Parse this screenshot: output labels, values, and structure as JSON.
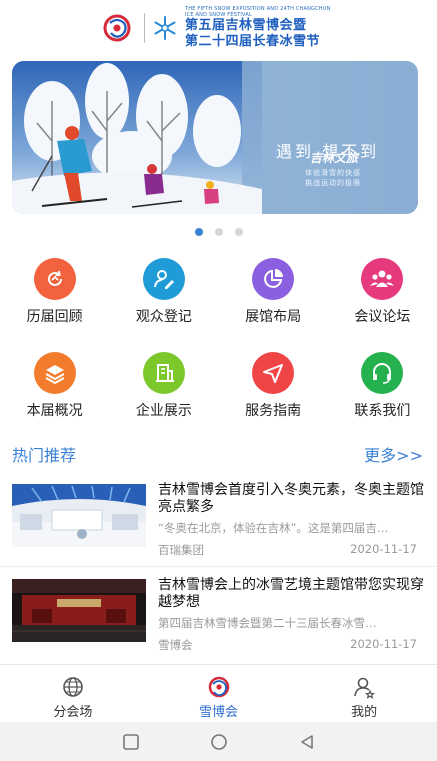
{
  "header": {
    "en_line": "THE FIFTH SNOW EXPOSITION AND 24TH CHANGCHUN ICE AND SNOW FESTIVAL",
    "cn_line1": "第五届吉林雪博会暨",
    "cn_line2": "第二十四届长春冰雪节"
  },
  "banner": {
    "brand": "吉林文旅",
    "slogan": "遇到 想不到",
    "sub1": "体验滑雪的快感",
    "sub2": "挑战运动的极限",
    "pages": 3,
    "active_page": 1
  },
  "grid": {
    "items": [
      {
        "label": "历届回顾",
        "icon": "history-icon",
        "color": "#f2623f"
      },
      {
        "label": "观众登记",
        "icon": "user-edit-icon",
        "color": "#1f9cd8"
      },
      {
        "label": "展馆布局",
        "icon": "pie-chart-icon",
        "color": "#8a5fe0"
      },
      {
        "label": "会议论坛",
        "icon": "group-icon",
        "color": "#e7397d"
      },
      {
        "label": "本届概况",
        "icon": "layers-icon",
        "color": "#f27c2c"
      },
      {
        "label": "企业展示",
        "icon": "building-icon",
        "color": "#7cc82c"
      },
      {
        "label": "服务指南",
        "icon": "navigation-icon",
        "color": "#f04546"
      },
      {
        "label": "联系我们",
        "icon": "headset-icon",
        "color": "#26b14f"
      }
    ]
  },
  "section": {
    "title": "热门推荐",
    "more": "更多>>"
  },
  "news": [
    {
      "title": "吉林雪博会首度引入冬奥元素，冬奥主题馆亮点繁多",
      "desc": "“冬奥在北京，体验在吉林”。这是第四届吉…",
      "source": "百瑞集团",
      "date": "2020-11-17"
    },
    {
      "title": "吉林雪博会上的冰雪艺境主题馆带您实现穿越梦想",
      "desc": "第四届吉林雪博会暨第二十三届长春冰雪…",
      "source": "雪博会",
      "date": "2020-11-17"
    }
  ],
  "tabs": [
    {
      "label": "分会场",
      "icon": "globe-icon"
    },
    {
      "label": "雪博会",
      "icon": "expo-logo-icon"
    },
    {
      "label": "我的",
      "icon": "profile-icon"
    }
  ],
  "active_tab": "雪博会",
  "colors": {
    "accent": "#3b82d6",
    "tab_active": "#2f6fd1"
  }
}
